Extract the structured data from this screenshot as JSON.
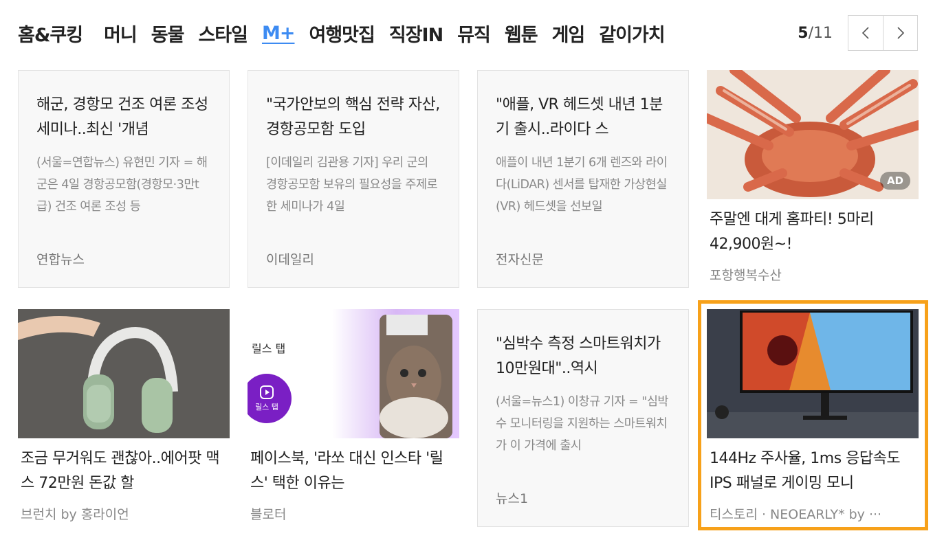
{
  "nav": {
    "items": [
      "홈&쿠킹",
      "머니",
      "동물",
      "스타일",
      "M+",
      "여행맛집",
      "직장IN",
      "뮤직",
      "웹툰",
      "게임",
      "같이가치"
    ],
    "active_index": 4
  },
  "pager": {
    "current": "5",
    "total": "/11",
    "prev_icon": "chevron-left-icon",
    "next_icon": "chevron-right-icon"
  },
  "cards": {
    "c1": {
      "title": "해군, 경항모 건조 여론 조성 세미나..최신 '개념",
      "desc": "(서울=연합뉴스) 유현민 기자 = 해군은 4일 경항공모함(경항모·3만t급) 건조 여론 조성 등",
      "source": "연합뉴스"
    },
    "c2": {
      "title": "\"국가안보의 핵심 전략 자산, 경항공모함 도입",
      "desc": "[이데일리 김관용 기자] 우리 군의 경항공모함 보유의 필요성을 주제로 한 세미나가 4일",
      "source": "이데일리"
    },
    "c3": {
      "title": "\"애플, VR 헤드셋 내년 1분기 출시..라이다 스",
      "desc": "애플이 내년 1분기 6개 렌즈와 라이다(LiDAR) 센서를 탑재한 가상현실(VR) 헤드셋을 선보일",
      "source": "전자신문"
    },
    "c4": {
      "title": "주말엔 대게 홈파티! 5마리 42,900원~!",
      "source": "포항행복수산",
      "badge": "AD"
    },
    "c5": {
      "title": "조금 무거워도 괜찮아..에어팟 맥스 72만원 돈값 할",
      "source": "브런치 by 홍라이언"
    },
    "c6": {
      "title": "페이스북, '라쏘 대신 인스타 '릴스' 택한 이유는",
      "source": "블로터",
      "thumb_text_top": "릴스 탭",
      "thumb_text_icon": "릴스 탭"
    },
    "c7": {
      "title": "\"심박수 측정 스마트워치가 10만원대\"..역시",
      "desc": "(서울=뉴스1) 이창규 기자 = \"심박수 모니터링을 지원하는 스마트워치가 이 가격에 출시",
      "source": "뉴스1"
    },
    "c8": {
      "title": "144Hz 주사율, 1ms 응답속도 IPS 패널로 게이밍 모니",
      "source": "티스토리 · NEOEARLY* by ···"
    }
  },
  "colors": {
    "accent": "#3d8bf2",
    "highlight": "#f7a11a"
  }
}
